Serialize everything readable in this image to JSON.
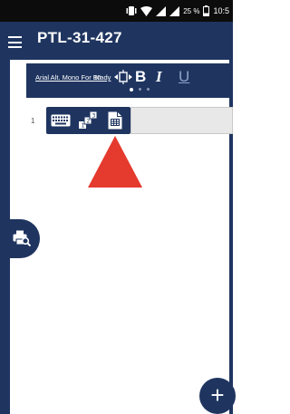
{
  "status_bar": {
    "battery_percent": "25 %",
    "time": "10:5"
  },
  "app_bar": {
    "title": "PTL-31-427",
    "menu_icon": "hamburger-menu-icon"
  },
  "format_toolbar": {
    "font_name": "Arial Alt. Mono For Brady",
    "font_size": "10",
    "bold_label": "B",
    "italic_label": "I",
    "underline_label": "U",
    "page_index": 1,
    "page_count": 3
  },
  "editor": {
    "row_number": "1",
    "row_tools": [
      "keyboard-icon",
      "serialize-icon",
      "data-table-icon"
    ]
  },
  "colors": {
    "primary": "#1f3560",
    "pointer": "#e53a2e",
    "statusbar": "#0c0c0c"
  }
}
